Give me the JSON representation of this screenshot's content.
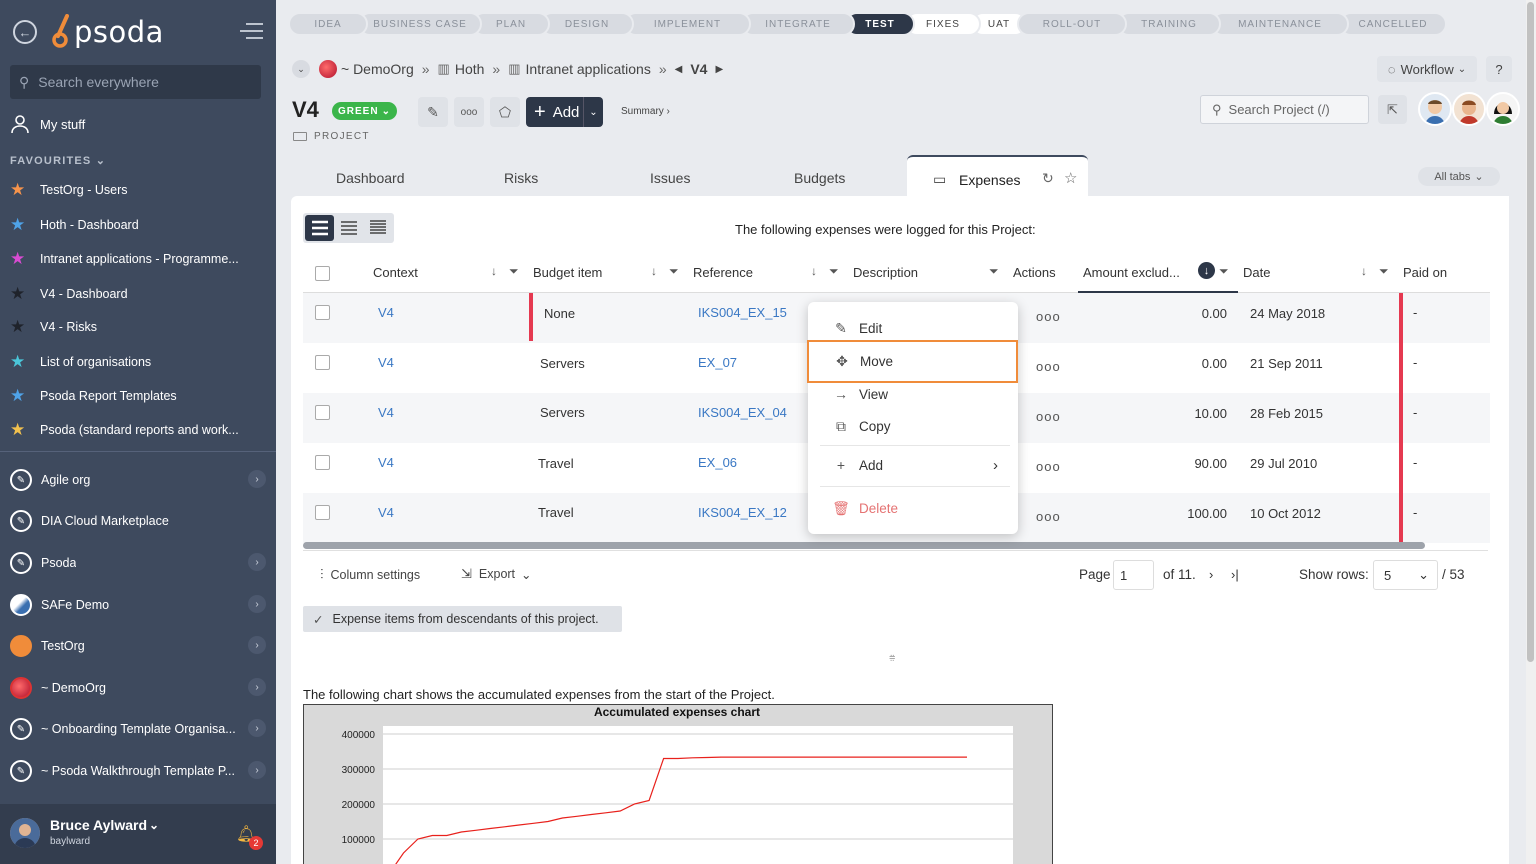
{
  "app": {
    "logo_text": "psoda"
  },
  "sidebar": {
    "search_placeholder": "Search everywhere",
    "my_stuff": "My stuff",
    "favourites_heading": "FAVOURITES",
    "favourites": [
      {
        "label": "TestOrg - Users",
        "star_color": "#f7944b"
      },
      {
        "label": "Hoth - Dashboard",
        "star_color": "#4fa3e8"
      },
      {
        "label": "Intranet applications - Programme...",
        "star_color": "#d94bd3"
      },
      {
        "label": "V4 - Dashboard",
        "star_color": "#2b2f38"
      },
      {
        "label": "V4 - Risks",
        "star_color": "#2b2f38"
      },
      {
        "label": "List of organisations",
        "star_color": "#4bc6d9"
      },
      {
        "label": "Psoda Report Templates",
        "star_color": "#4fa3e8"
      },
      {
        "label": "Psoda (standard reports and work...",
        "star_color": "#f2c14e"
      }
    ],
    "orgs": [
      {
        "label": "Agile org",
        "icon": "compass"
      },
      {
        "label": "DIA Cloud Marketplace",
        "icon": "compass"
      },
      {
        "label": "Psoda",
        "icon": "compass"
      },
      {
        "label": "SAFe Demo",
        "icon": "safe"
      },
      {
        "label": "TestOrg",
        "icon": "orange"
      },
      {
        "label": "~ DemoOrg",
        "icon": "red"
      },
      {
        "label": "~ Onboarding Template Organisa...",
        "icon": "compass"
      },
      {
        "label": "~ Psoda Walkthrough Template P...",
        "icon": "compass"
      }
    ],
    "user": {
      "name": "Bruce Aylward",
      "username": "baylward",
      "notifications": "2"
    }
  },
  "stages": [
    {
      "label": "IDEA",
      "state": "past"
    },
    {
      "label": "BUSINESS CASE",
      "state": "past"
    },
    {
      "label": "PLAN",
      "state": "past"
    },
    {
      "label": "DESIGN",
      "state": "past"
    },
    {
      "label": "IMPLEMENT",
      "state": "past"
    },
    {
      "label": "INTEGRATE",
      "state": "past"
    },
    {
      "label": "TEST",
      "state": "active"
    },
    {
      "label": "FIXES",
      "state": "after"
    },
    {
      "label": "UAT",
      "state": "after"
    },
    {
      "label": "ROLL-OUT",
      "state": "past"
    },
    {
      "label": "TRAINING",
      "state": "past"
    },
    {
      "label": "MAINTENANCE",
      "state": "past"
    },
    {
      "label": "CANCELLED",
      "state": "past"
    }
  ],
  "breadcrumb": {
    "org": "~ DemoOrg",
    "programme": "Hoth",
    "project_group": "Intranet applications",
    "current": "V4",
    "sep": "»"
  },
  "workflow_label": "Workflow",
  "help_label": "?",
  "project": {
    "name": "V4",
    "status": "GREEN",
    "type": "PROJECT",
    "add_label": "Add",
    "summary_label": "Summary ›"
  },
  "project_search_placeholder": "Search Project (/)",
  "tabs": {
    "items": [
      "Dashboard",
      "Risks",
      "Issues",
      "Budgets"
    ],
    "active": "Expenses",
    "all_tabs": "All tabs"
  },
  "expenses": {
    "intro": "The following expenses were logged for this Project:",
    "columns": [
      "Context",
      "Budget item",
      "Reference",
      "Description",
      "Actions",
      "Amount exclud...",
      "Date",
      "Paid on"
    ],
    "rows": [
      {
        "context": "V4",
        "budget_item": "None",
        "reference": "IKS004_EX_15",
        "amount": "0.00",
        "date": "24 May 2018",
        "paid_on": "-"
      },
      {
        "context": "V4",
        "budget_item": "Servers",
        "reference": "EX_07",
        "amount": "0.00",
        "date": "21 Sep 2011",
        "paid_on": "-"
      },
      {
        "context": "V4",
        "budget_item": "Servers",
        "reference": "IKS004_EX_04",
        "amount": "10.00",
        "date": "28 Feb 2015",
        "paid_on": "-"
      },
      {
        "context": "V4",
        "budget_item": "Travel",
        "reference": "EX_06",
        "amount": "90.00",
        "date": "29 Jul 2010",
        "paid_on": "-"
      },
      {
        "context": "V4",
        "budget_item": "Travel",
        "reference": "IKS004_EX_12",
        "amount": "100.00",
        "date": "10 Oct 2012",
        "paid_on": "-"
      }
    ],
    "actions_glyph": "ooo",
    "column_settings": "Column settings",
    "export": "Export",
    "page_label": "Page",
    "page": "1",
    "of_pages": "of 11.",
    "show_rows_label": "Show rows:",
    "rows_per_page": "5",
    "total": "/ 53",
    "descendants_label": "Expense items from descendants of this project.",
    "chart_intro": "The following chart shows the accumulated expenses from the start of the Project."
  },
  "context_menu": {
    "items": [
      {
        "label": "Edit",
        "icon": "pencil-icon"
      },
      {
        "label": "Move",
        "icon": "move-icon"
      },
      {
        "label": "View",
        "icon": "arrow-right-icon"
      },
      {
        "label": "Copy",
        "icon": "copy-icon"
      },
      {
        "label": "Add",
        "icon": "plus-icon"
      },
      {
        "label": "Delete",
        "icon": "trash-icon"
      }
    ],
    "highlighted": "Move"
  },
  "chart_data": {
    "type": "line",
    "title": "Accumulated expenses chart",
    "ylim": [
      0,
      400000
    ],
    "yticks": [
      100000,
      200000,
      300000,
      400000
    ],
    "x": [
      0,
      1,
      2,
      3,
      4,
      5,
      6,
      7,
      8,
      9,
      10,
      11,
      12,
      13,
      14,
      15,
      16,
      17,
      18,
      19,
      20,
      21,
      22,
      23,
      24,
      25,
      26,
      27,
      28,
      29,
      30,
      31,
      32,
      33,
      34,
      35,
      36,
      37,
      38,
      39,
      40
    ],
    "series": [
      {
        "color": "#e8211c",
        "values": [
          0,
          60000,
          100000,
          110000,
          110000,
          120000,
          125000,
          130000,
          135000,
          140000,
          145000,
          150000,
          160000,
          165000,
          170000,
          175000,
          180000,
          200000,
          210000,
          330000,
          330000,
          332000,
          333000,
          334000,
          334000,
          334000,
          334000,
          334000,
          334000,
          334000,
          334000,
          334000,
          334000,
          334000,
          334000,
          334000,
          334000,
          334000,
          334000,
          334000,
          334000
        ]
      }
    ],
    "grid": true
  },
  "colors": {
    "sidebar": "#3e4a5e",
    "active_stage": "#2d3748",
    "status_green": "#3bb54a",
    "link": "#3a78c4",
    "highlight": "#f08c3a",
    "danger": "#e57373"
  }
}
